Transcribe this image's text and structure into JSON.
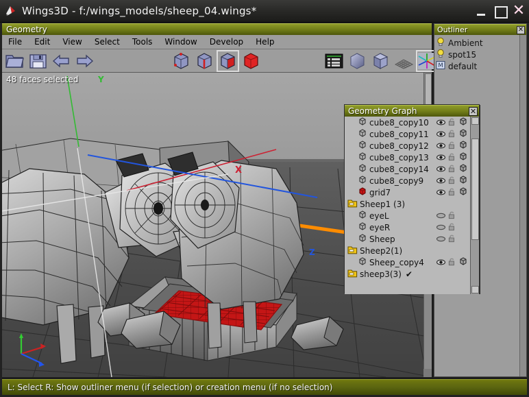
{
  "window": {
    "title": "Wings3D - f:/wings_models/sheep_04.wings*",
    "app_icon": "wings3d-logo-icon",
    "minimize_label": "_",
    "maximize_label": "□",
    "close_label": "✕"
  },
  "geometry_panel": {
    "title": "Geometry",
    "menu": [
      {
        "label": "File"
      },
      {
        "label": "Edit"
      },
      {
        "label": "View"
      },
      {
        "label": "Select"
      },
      {
        "label": "Tools"
      },
      {
        "label": "Window"
      },
      {
        "label": "Develop"
      },
      {
        "label": "Help"
      }
    ],
    "toolbar_left": [
      {
        "name": "open-file-icon",
        "tip": "Open"
      },
      {
        "name": "save-file-icon",
        "tip": "Save"
      },
      {
        "name": "undo-arrow-icon",
        "tip": "Undo"
      },
      {
        "name": "redo-arrow-icon",
        "tip": "Redo"
      }
    ],
    "selection_modes": [
      {
        "name": "vertex-mode-icon",
        "label": "Vertex",
        "active": false
      },
      {
        "name": "edge-mode-icon",
        "label": "Edge",
        "active": false
      },
      {
        "name": "face-mode-icon",
        "label": "Face",
        "active": true
      },
      {
        "name": "body-mode-icon",
        "label": "Body",
        "active": false
      }
    ],
    "view_modes": [
      {
        "name": "properties-panel-icon",
        "label": "Properties",
        "active": false
      },
      {
        "name": "smooth-shade-icon",
        "label": "Smooth Shading",
        "active": false
      },
      {
        "name": "flat-shade-icon",
        "label": "Flat Shading",
        "active": false
      },
      {
        "name": "wireframe-icon",
        "label": "Wireframe",
        "active": false
      },
      {
        "name": "show-axes-icon",
        "label": "Show Axes",
        "active": true
      }
    ]
  },
  "viewport": {
    "status": "48 faces selected",
    "axis_labels": {
      "x": "X",
      "y": "Y",
      "z": "Z"
    },
    "colors": {
      "axis_x": "#cc2233",
      "axis_y": "#33bb33",
      "axis_z": "#2255dd",
      "selection": "#cc1a1a",
      "highlight_edge": "#ff8c00",
      "ground": "#4a4a4a",
      "sky": "#a0a0a0"
    }
  },
  "outliner": {
    "title": "Outliner",
    "close_label": "✕",
    "items": [
      {
        "label": "Ambient",
        "icon": "light-bulb-icon"
      },
      {
        "label": "spot15",
        "icon": "light-bulb-icon"
      },
      {
        "label": "default",
        "icon": "material-m-icon"
      }
    ]
  },
  "geometry_graph": {
    "title": "Geometry Graph",
    "close_label": "✕",
    "rows": [
      {
        "label": "cube8_copy10",
        "type": "object",
        "icon": "wire-cube-icon",
        "indent": 1,
        "eye": "open",
        "lock": "unlocked",
        "wire": true,
        "checked": false
      },
      {
        "label": "cube8_copy11",
        "type": "object",
        "icon": "wire-cube-icon",
        "indent": 1,
        "eye": "open",
        "lock": "unlocked",
        "wire": true,
        "checked": false
      },
      {
        "label": "cube8_copy12",
        "type": "object",
        "icon": "wire-cube-icon",
        "indent": 1,
        "eye": "open",
        "lock": "unlocked",
        "wire": true,
        "checked": false
      },
      {
        "label": "cube8_copy13",
        "type": "object",
        "icon": "wire-cube-icon",
        "indent": 1,
        "eye": "open",
        "lock": "unlocked",
        "wire": true,
        "checked": false
      },
      {
        "label": "cube8_copy14",
        "type": "object",
        "icon": "wire-cube-icon",
        "indent": 1,
        "eye": "open",
        "lock": "unlocked",
        "wire": true,
        "checked": false
      },
      {
        "label": "cube8_copy9",
        "type": "object",
        "icon": "wire-cube-icon",
        "indent": 1,
        "eye": "open",
        "lock": "unlocked",
        "wire": true,
        "checked": false
      },
      {
        "label": "grid7",
        "type": "object",
        "icon": "red-cube-icon",
        "indent": 1,
        "eye": "open",
        "lock": "unlocked",
        "wire": true,
        "checked": false
      },
      {
        "label": "Sheep1 (3)",
        "type": "folder",
        "icon": "folder-icon",
        "indent": 0,
        "eye": "none",
        "lock": "none",
        "wire": false,
        "checked": false
      },
      {
        "label": "eyeL",
        "type": "object",
        "icon": "wire-cube-icon",
        "indent": 1,
        "eye": "closed",
        "lock": "unlocked",
        "wire": false,
        "checked": false
      },
      {
        "label": "eyeR",
        "type": "object",
        "icon": "wire-cube-icon",
        "indent": 1,
        "eye": "closed",
        "lock": "unlocked",
        "wire": false,
        "checked": false
      },
      {
        "label": "Sheep",
        "type": "object",
        "icon": "wire-cube-icon",
        "indent": 1,
        "eye": "closed",
        "lock": "unlocked",
        "wire": false,
        "checked": false
      },
      {
        "label": "Sheep2(1)",
        "type": "folder",
        "icon": "folder-icon",
        "indent": 0,
        "eye": "none",
        "lock": "none",
        "wire": false,
        "checked": false
      },
      {
        "label": "Sheep_copy4",
        "type": "object",
        "icon": "wire-cube-icon",
        "indent": 1,
        "eye": "open",
        "lock": "unlocked",
        "wire": true,
        "checked": false
      },
      {
        "label": "sheep3(3)",
        "type": "folder",
        "icon": "folder-icon",
        "indent": 0,
        "eye": "none",
        "lock": "none",
        "wire": false,
        "checked": true
      }
    ],
    "check_glyph": "✔"
  },
  "statusbar": {
    "text": "L: Select   R: Show outliner menu (if selection) or creation menu (if no selection)"
  }
}
